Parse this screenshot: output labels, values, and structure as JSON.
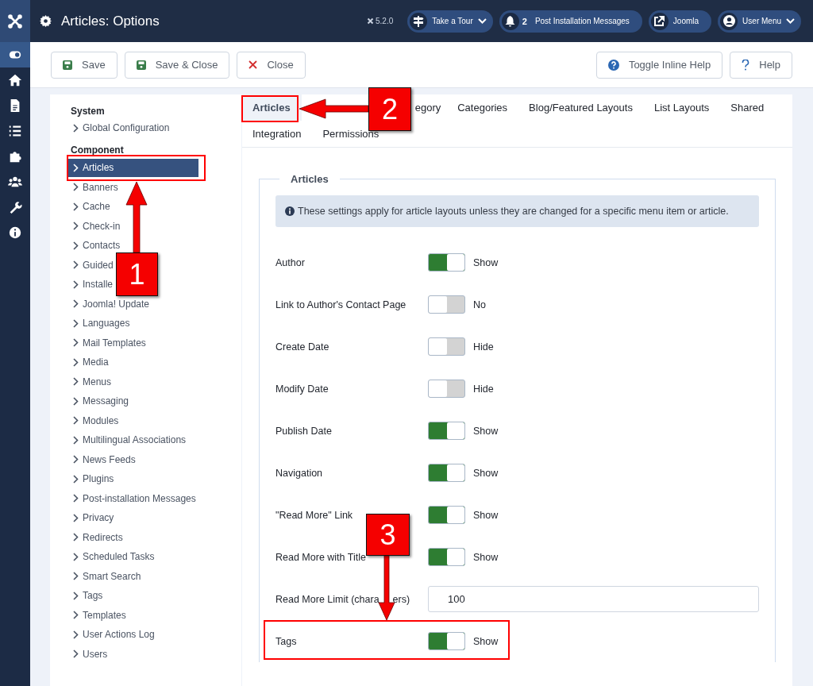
{
  "header": {
    "title": "Articles: Options",
    "version": "5.2.0",
    "buttons": [
      {
        "kind": "tour",
        "label": "Take a Tour"
      },
      {
        "kind": "messages",
        "count": "2",
        "label": "Post Installation Messages"
      },
      {
        "kind": "link",
        "label": "Joomla"
      },
      {
        "kind": "user",
        "label": "User Menu"
      }
    ]
  },
  "toolbar": {
    "left": [
      {
        "kind": "save",
        "label": "Save"
      },
      {
        "kind": "save",
        "label": "Save & Close"
      },
      {
        "kind": "close",
        "label": "Close"
      }
    ],
    "right": [
      {
        "kind": "inline-help",
        "label": "Toggle Inline Help"
      },
      {
        "kind": "help",
        "label": "Help"
      }
    ]
  },
  "sidebar": {
    "groups": [
      {
        "title": "System",
        "items": [
          {
            "label": "Global Configuration",
            "selected": false
          }
        ]
      },
      {
        "title": "Component",
        "items": [
          {
            "label": "Articles",
            "selected": true
          },
          {
            "label": "Banners",
            "selected": false
          },
          {
            "label": "Cache",
            "selected": false
          },
          {
            "label": "Check-in",
            "selected": false
          },
          {
            "label": "Contacts",
            "selected": false
          },
          {
            "label": "Guided",
            "selected": false
          },
          {
            "label": "Installe",
            "selected": false
          },
          {
            "label": "Joomla! Update",
            "selected": false
          },
          {
            "label": "Languages",
            "selected": false
          },
          {
            "label": "Mail Templates",
            "selected": false
          },
          {
            "label": "Media",
            "selected": false
          },
          {
            "label": "Menus",
            "selected": false
          },
          {
            "label": "Messaging",
            "selected": false
          },
          {
            "label": "Modules",
            "selected": false
          },
          {
            "label": "Multilingual Associations",
            "selected": false
          },
          {
            "label": "News Feeds",
            "selected": false
          },
          {
            "label": "Plugins",
            "selected": false
          },
          {
            "label": "Post-installation Messages",
            "selected": false
          },
          {
            "label": "Privacy",
            "selected": false
          },
          {
            "label": "Redirects",
            "selected": false
          },
          {
            "label": "Scheduled Tasks",
            "selected": false
          },
          {
            "label": "Smart Search",
            "selected": false
          },
          {
            "label": "Tags",
            "selected": false
          },
          {
            "label": "Templates",
            "selected": false
          },
          {
            "label": "User Actions Log",
            "selected": false
          },
          {
            "label": "Users",
            "selected": false
          }
        ]
      }
    ]
  },
  "tabs": [
    [
      {
        "label": "Articles",
        "selected": true
      },
      {
        "label": "egory",
        "selected": false
      },
      {
        "label": "Categories",
        "selected": false
      },
      {
        "label": "Blog/Featured Layouts",
        "selected": false
      },
      {
        "label": "List Layouts",
        "selected": false
      },
      {
        "label": "Shared",
        "selected": false
      }
    ],
    [
      {
        "label": "Integration",
        "selected": false
      },
      {
        "label": "Permissions",
        "selected": false
      }
    ]
  ],
  "fieldset": {
    "legend": "Articles",
    "info": "These settings apply for article layouts unless they are changed for a specific menu item or article.",
    "options": [
      {
        "kind": "switch",
        "label": "Author",
        "on": true,
        "value": "Show"
      },
      {
        "kind": "switch",
        "label": "Link to Author's Contact Page",
        "on": false,
        "value": "No"
      },
      {
        "kind": "switch",
        "label": "Create Date",
        "on": false,
        "value": "Hide"
      },
      {
        "kind": "switch",
        "label": "Modify Date",
        "on": false,
        "value": "Hide"
      },
      {
        "kind": "switch",
        "label": "Publish Date",
        "on": true,
        "value": "Show"
      },
      {
        "kind": "switch",
        "label": "Navigation",
        "on": true,
        "value": "Show"
      },
      {
        "kind": "switch",
        "label": "\"Read More\" Link",
        "on": true,
        "value": "Show"
      },
      {
        "kind": "switch",
        "label": "Read More with Title",
        "on": true,
        "value": "Show"
      },
      {
        "kind": "number",
        "label": "Read More Limit (chara",
        "label_end": "ers)",
        "value": "100"
      },
      {
        "kind": "switch",
        "label": "Tags",
        "on": true,
        "value": "Show"
      }
    ]
  },
  "annotations": [
    {
      "number": "1"
    },
    {
      "number": "2"
    },
    {
      "number": "3"
    }
  ]
}
